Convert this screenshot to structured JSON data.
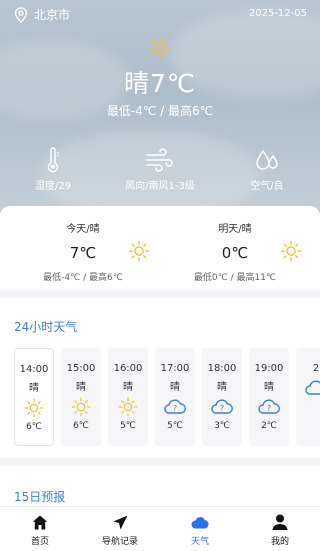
{
  "header": {
    "location": "北京市",
    "date": "2025-12-05"
  },
  "current": {
    "condition": "晴7℃",
    "range": "最低-4℃ / 最高6℃"
  },
  "stats": [
    {
      "icon": "thermometer-icon",
      "label": "湿度/29"
    },
    {
      "icon": "wind-icon",
      "label": "风向/南风1-3级"
    },
    {
      "icon": "water-drops-icon",
      "label": "空气/良"
    }
  ],
  "today": {
    "title": "今天/晴",
    "temp": "7℃",
    "range": "最低-4℃ / 最高6℃",
    "icon": "sun-icon"
  },
  "tomorrow": {
    "title": "明天/晴",
    "temp": "0℃",
    "range": "最低0℃ / 最高11℃",
    "icon": "sun-icon"
  },
  "hourly": {
    "title": "24小时天气",
    "items": [
      {
        "time": "14:00",
        "cond": "晴",
        "icon": "sun-icon",
        "temp": "6℃"
      },
      {
        "time": "15:00",
        "cond": "晴",
        "icon": "sun-icon",
        "temp": "6℃"
      },
      {
        "time": "16:00",
        "cond": "晴",
        "icon": "sun-icon",
        "temp": "5℃"
      },
      {
        "time": "17:00",
        "cond": "晴",
        "icon": "unknown-cloud-icon",
        "temp": "5℃"
      },
      {
        "time": "18:00",
        "cond": "晴",
        "icon": "unknown-cloud-icon",
        "temp": "3℃"
      },
      {
        "time": "19:00",
        "cond": "晴",
        "icon": "unknown-cloud-icon",
        "temp": "2℃"
      },
      {
        "time": "2",
        "cond": "",
        "icon": "unknown-cloud-icon",
        "temp": ""
      }
    ]
  },
  "forecast15": {
    "title": "15日预报"
  },
  "nav": [
    {
      "label": "首页",
      "icon": "home-icon"
    },
    {
      "label": "导航记录",
      "icon": "send-icon"
    },
    {
      "label": "天气",
      "icon": "cloud-icon",
      "active": true
    },
    {
      "label": "我的",
      "icon": "user-icon"
    }
  ],
  "colors": {
    "accent": "#2a72e6",
    "title_blue": "#3d7ee6",
    "sun": "#f2c037"
  }
}
